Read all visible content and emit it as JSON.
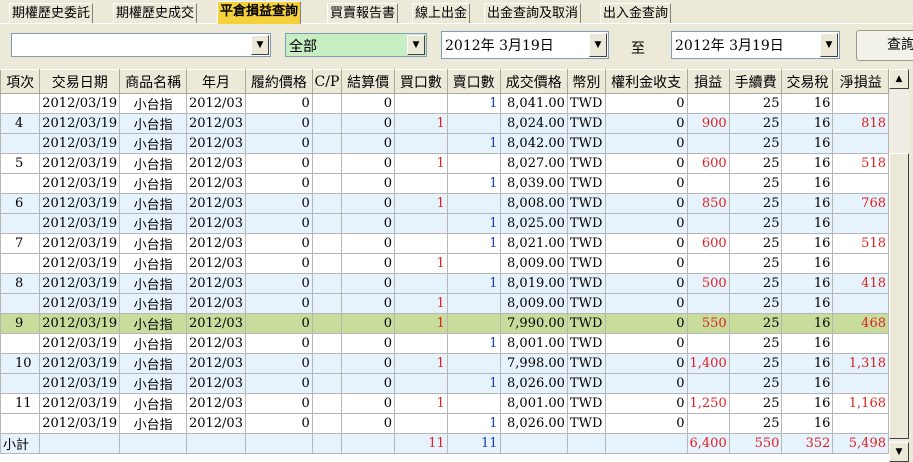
{
  "tabs": [
    {
      "label": "期權歷史委託",
      "active": false
    },
    {
      "label": "期權歷史成交",
      "active": false
    },
    {
      "label": "平倉損益查詢",
      "active": true
    },
    {
      "label": "買賣報告書",
      "active": false
    },
    {
      "label": "線上出金",
      "active": false
    },
    {
      "label": "出金查詢及取消",
      "active": false
    },
    {
      "label": "出入金查詢",
      "active": false
    }
  ],
  "filters": {
    "account": "",
    "category": "全部",
    "date_from": "2012年  3月19日",
    "to_label": "至",
    "date_to": "2012年  3月19日",
    "query_label": "查詢"
  },
  "columns": [
    "項次",
    "交易日期",
    "商品名稱",
    "年月",
    "履約價格",
    "C/P",
    "結算價",
    "買口數",
    "賣口數",
    "成交價格",
    "幣別",
    "權利金收支",
    "損益",
    "手續費",
    "交易稅",
    "淨損益"
  ],
  "rows": [
    {
      "no": "",
      "date": "2012/03/19",
      "product": "小台指",
      "ym": "2012/03",
      "strike": "0",
      "cp": "",
      "settle": "0",
      "buy": "",
      "sell": "1",
      "price": "8,041.00",
      "cur": "TWD",
      "premium": "0",
      "pl": "",
      "fee": "25",
      "tax": "16",
      "net": "",
      "style": "odd"
    },
    {
      "no": "4",
      "date": "2012/03/19",
      "product": "小台指",
      "ym": "2012/03",
      "strike": "0",
      "cp": "",
      "settle": "0",
      "buy": "1",
      "sell": "",
      "price": "8,024.00",
      "cur": "TWD",
      "premium": "0",
      "pl": "900",
      "fee": "25",
      "tax": "16",
      "net": "818",
      "style": "even"
    },
    {
      "no": "",
      "date": "2012/03/19",
      "product": "小台指",
      "ym": "2012/03",
      "strike": "0",
      "cp": "",
      "settle": "0",
      "buy": "",
      "sell": "1",
      "price": "8,042.00",
      "cur": "TWD",
      "premium": "0",
      "pl": "",
      "fee": "25",
      "tax": "16",
      "net": "",
      "style": "even"
    },
    {
      "no": "5",
      "date": "2012/03/19",
      "product": "小台指",
      "ym": "2012/03",
      "strike": "0",
      "cp": "",
      "settle": "0",
      "buy": "1",
      "sell": "",
      "price": "8,027.00",
      "cur": "TWD",
      "premium": "0",
      "pl": "600",
      "fee": "25",
      "tax": "16",
      "net": "518",
      "style": "odd"
    },
    {
      "no": "",
      "date": "2012/03/19",
      "product": "小台指",
      "ym": "2012/03",
      "strike": "0",
      "cp": "",
      "settle": "0",
      "buy": "",
      "sell": "1",
      "price": "8,039.00",
      "cur": "TWD",
      "premium": "0",
      "pl": "",
      "fee": "25",
      "tax": "16",
      "net": "",
      "style": "odd"
    },
    {
      "no": "6",
      "date": "2012/03/19",
      "product": "小台指",
      "ym": "2012/03",
      "strike": "0",
      "cp": "",
      "settle": "0",
      "buy": "1",
      "sell": "",
      "price": "8,008.00",
      "cur": "TWD",
      "premium": "0",
      "pl": "850",
      "fee": "25",
      "tax": "16",
      "net": "768",
      "style": "even"
    },
    {
      "no": "",
      "date": "2012/03/19",
      "product": "小台指",
      "ym": "2012/03",
      "strike": "0",
      "cp": "",
      "settle": "0",
      "buy": "",
      "sell": "1",
      "price": "8,025.00",
      "cur": "TWD",
      "premium": "0",
      "pl": "",
      "fee": "25",
      "tax": "16",
      "net": "",
      "style": "even"
    },
    {
      "no": "7",
      "date": "2012/03/19",
      "product": "小台指",
      "ym": "2012/03",
      "strike": "0",
      "cp": "",
      "settle": "0",
      "buy": "",
      "sell": "1",
      "price": "8,021.00",
      "cur": "TWD",
      "premium": "0",
      "pl": "600",
      "fee": "25",
      "tax": "16",
      "net": "518",
      "style": "odd"
    },
    {
      "no": "",
      "date": "2012/03/19",
      "product": "小台指",
      "ym": "2012/03",
      "strike": "0",
      "cp": "",
      "settle": "0",
      "buy": "1",
      "sell": "",
      "price": "8,009.00",
      "cur": "TWD",
      "premium": "0",
      "pl": "",
      "fee": "25",
      "tax": "16",
      "net": "",
      "style": "odd"
    },
    {
      "no": "8",
      "date": "2012/03/19",
      "product": "小台指",
      "ym": "2012/03",
      "strike": "0",
      "cp": "",
      "settle": "0",
      "buy": "",
      "sell": "1",
      "price": "8,019.00",
      "cur": "TWD",
      "premium": "0",
      "pl": "500",
      "fee": "25",
      "tax": "16",
      "net": "418",
      "style": "even"
    },
    {
      "no": "",
      "date": "2012/03/19",
      "product": "小台指",
      "ym": "2012/03",
      "strike": "0",
      "cp": "",
      "settle": "0",
      "buy": "1",
      "sell": "",
      "price": "8,009.00",
      "cur": "TWD",
      "premium": "0",
      "pl": "",
      "fee": "25",
      "tax": "16",
      "net": "",
      "style": "even"
    },
    {
      "no": "9",
      "date": "2012/03/19",
      "product": "小台指",
      "ym": "2012/03",
      "strike": "0",
      "cp": "",
      "settle": "0",
      "buy": "1",
      "sell": "",
      "price": "7,990.00",
      "cur": "TWD",
      "premium": "0",
      "pl": "550",
      "fee": "25",
      "tax": "16",
      "net": "468",
      "style": "sel"
    },
    {
      "no": "",
      "date": "2012/03/19",
      "product": "小台指",
      "ym": "2012/03",
      "strike": "0",
      "cp": "",
      "settle": "0",
      "buy": "",
      "sell": "1",
      "price": "8,001.00",
      "cur": "TWD",
      "premium": "0",
      "pl": "",
      "fee": "25",
      "tax": "16",
      "net": "",
      "style": "odd"
    },
    {
      "no": "10",
      "date": "2012/03/19",
      "product": "小台指",
      "ym": "2012/03",
      "strike": "0",
      "cp": "",
      "settle": "0",
      "buy": "1",
      "sell": "",
      "price": "7,998.00",
      "cur": "TWD",
      "premium": "0",
      "pl": "1,400",
      "fee": "25",
      "tax": "16",
      "net": "1,318",
      "style": "even"
    },
    {
      "no": "",
      "date": "2012/03/19",
      "product": "小台指",
      "ym": "2012/03",
      "strike": "0",
      "cp": "",
      "settle": "0",
      "buy": "",
      "sell": "1",
      "price": "8,026.00",
      "cur": "TWD",
      "premium": "0",
      "pl": "",
      "fee": "25",
      "tax": "16",
      "net": "",
      "style": "even"
    },
    {
      "no": "11",
      "date": "2012/03/19",
      "product": "小台指",
      "ym": "2012/03",
      "strike": "0",
      "cp": "",
      "settle": "0",
      "buy": "1",
      "sell": "",
      "price": "8,001.00",
      "cur": "TWD",
      "premium": "0",
      "pl": "1,250",
      "fee": "25",
      "tax": "16",
      "net": "1,168",
      "style": "odd"
    },
    {
      "no": "",
      "date": "2012/03/19",
      "product": "小台指",
      "ym": "2012/03",
      "strike": "0",
      "cp": "",
      "settle": "0",
      "buy": "",
      "sell": "1",
      "price": "8,026.00",
      "cur": "TWD",
      "premium": "0",
      "pl": "",
      "fee": "25",
      "tax": "16",
      "net": "",
      "style": "odd"
    }
  ],
  "subtotal": {
    "label": "小計",
    "buy": "11",
    "sell": "11",
    "pl": "6,400",
    "fee": "550",
    "tax": "352",
    "net": "5,498"
  },
  "colors": {
    "tab_active": "#f5d03b",
    "row_alt": "#e6f2fc",
    "row_selected": "#c8dd9c",
    "num_red": "#d22",
    "num_blue": "#1c3fb6"
  },
  "icons": {
    "dropdown": "chevron-down-icon",
    "scroll_up": "arrow-up-icon",
    "scroll_down": "arrow-down-icon"
  }
}
